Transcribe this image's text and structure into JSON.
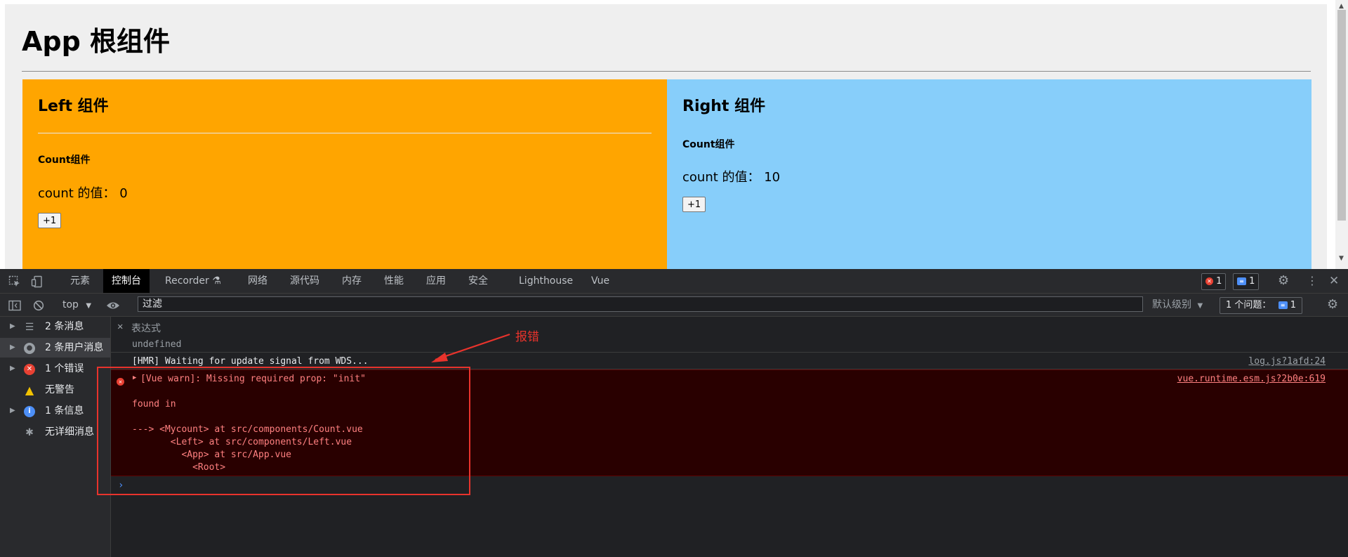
{
  "page": {
    "app_title": "App 根组件",
    "left": {
      "title": "Left 组件",
      "count_title": "Count组件",
      "count_text": "count 的值： 0",
      "button_label": "+1",
      "background": "#ffa500"
    },
    "right": {
      "title": "Right 组件",
      "count_title": "Count组件",
      "count_text": "count 的值： 10",
      "button_label": "+1",
      "background": "#87cefa"
    }
  },
  "devtools": {
    "tabs": [
      {
        "label": "元素"
      },
      {
        "label": "控制台"
      },
      {
        "label": "Recorder ⚗"
      },
      {
        "label": "网络"
      },
      {
        "label": "源代码"
      },
      {
        "label": "内存"
      },
      {
        "label": "性能"
      },
      {
        "label": "应用"
      },
      {
        "label": "安全"
      },
      {
        "label": "Lighthouse"
      },
      {
        "label": "Vue"
      }
    ],
    "active_tab": "控制台",
    "error_count": "1",
    "message_count": "1",
    "toolbar": {
      "context": "top",
      "filter_placeholder": "过滤",
      "levels": "默认级别",
      "issues_label": "1 个问题：",
      "issues_count": "1"
    },
    "sidebar": [
      {
        "label": "2 条消息",
        "icon": "list-icon"
      },
      {
        "label": "2 条用户消息",
        "icon": "user-icon"
      },
      {
        "label": "1 个错误",
        "icon": "error-icon"
      },
      {
        "label": "无警告",
        "icon": "warning-icon"
      },
      {
        "label": "1 条信息",
        "icon": "info-icon"
      },
      {
        "label": "无详细消息",
        "icon": "bug-icon"
      }
    ],
    "console": {
      "expression_label": "表达式",
      "expression_value": "undefined",
      "hmr_text": "[HMR] Waiting for update signal from WDS...",
      "hmr_source": "log.js?1afd:24",
      "warn_text": "[Vue warn]: Missing required prop: \"init\"",
      "warn_source": "vue.runtime.esm.js?2b0e:619",
      "trace": [
        "found in",
        "---> <Mycount> at src/components/Count.vue",
        "       <Left> at src/components/Left.vue",
        "         <App> at src/App.vue",
        "           <Root>"
      ],
      "prompt": "›"
    }
  },
  "annotation": {
    "label": "报错",
    "color": "#e8332c"
  }
}
